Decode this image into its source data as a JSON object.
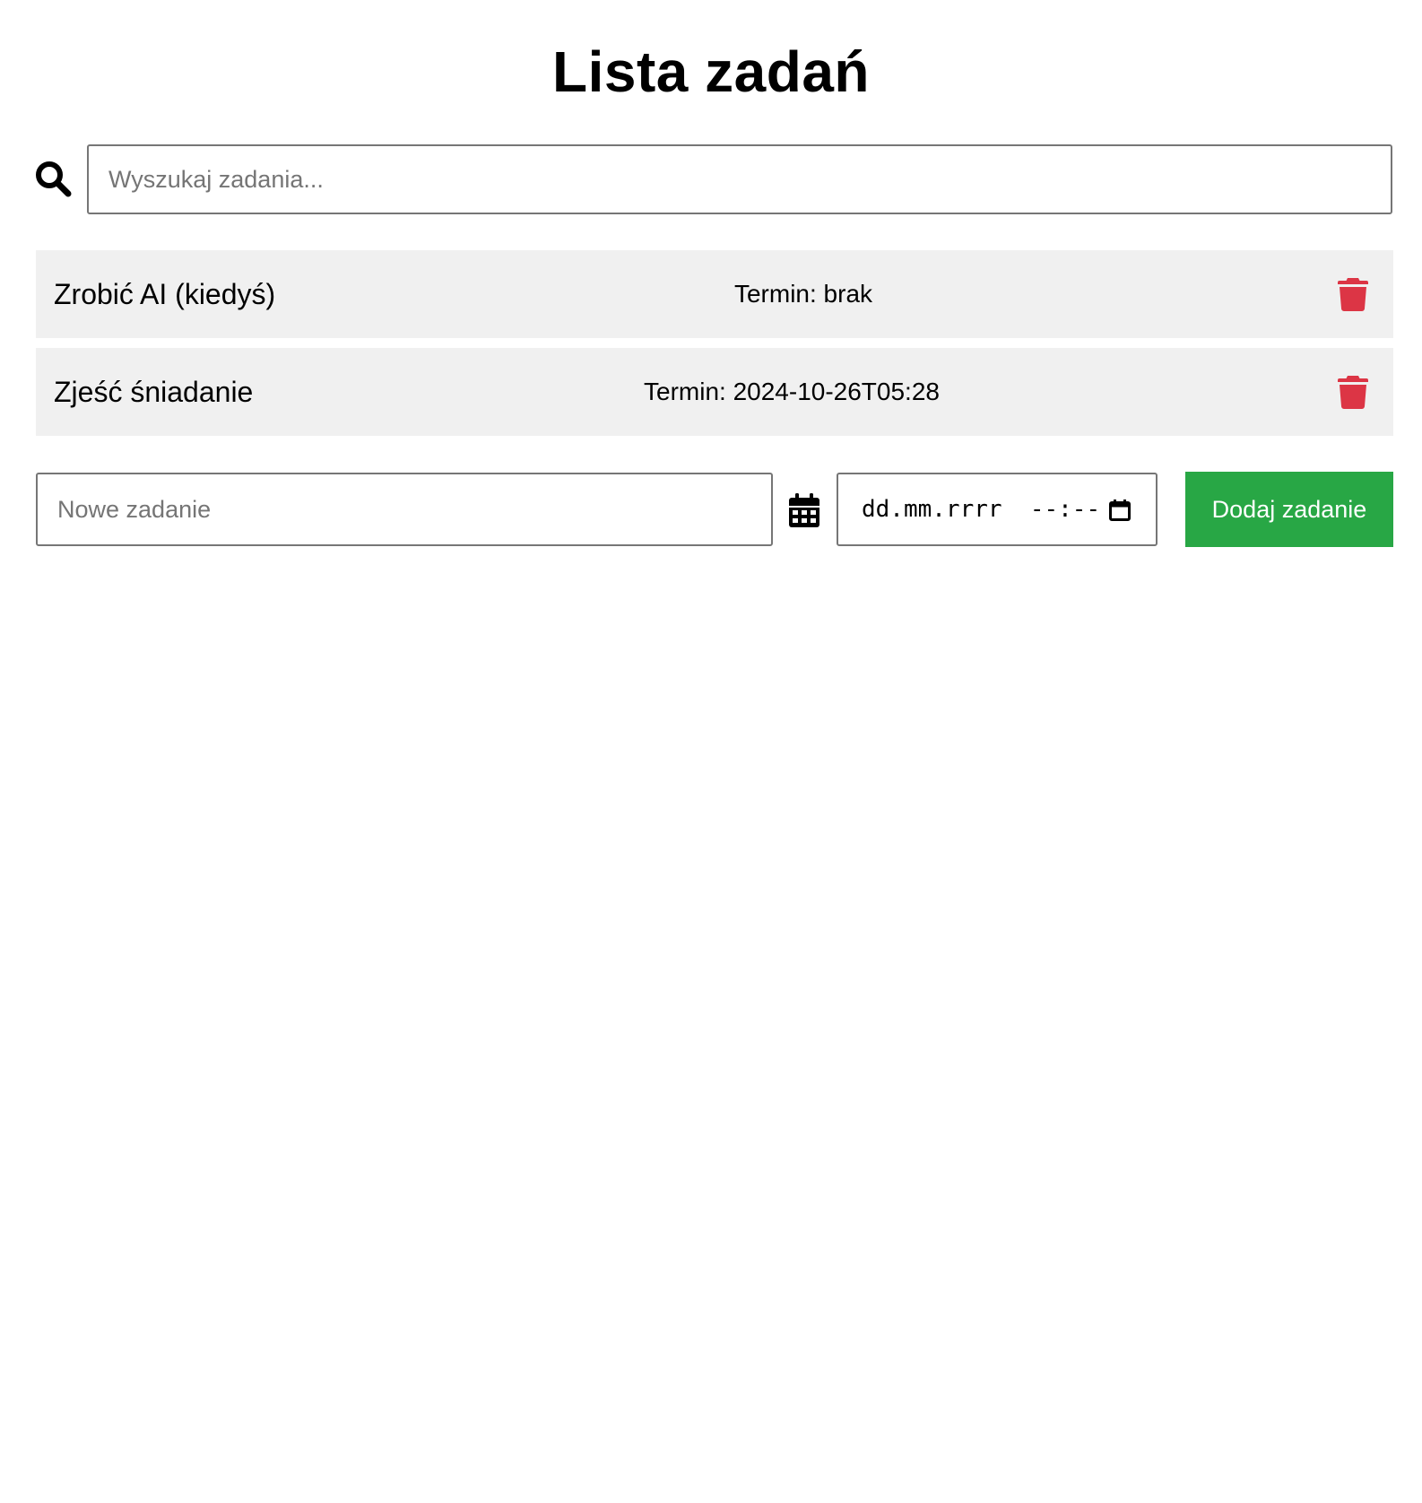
{
  "header": {
    "title": "Lista zadań"
  },
  "search": {
    "icon": "search-icon",
    "placeholder": "Wyszukaj zadania...",
    "value": ""
  },
  "tasks": [
    {
      "name": "Zrobić AI (kiedyś)",
      "deadline": "Termin: brak",
      "delete_icon": "trash-icon"
    },
    {
      "name": "Zjeść śniadanie",
      "deadline": "Termin: 2024-10-26T05:28",
      "delete_icon": "trash-icon"
    }
  ],
  "new_task": {
    "placeholder": "Nowe zadanie",
    "value": "",
    "calendar_icon": "calendar-icon",
    "date_placeholder": "dd.mm.rrrr  --:--",
    "add_label": "Dodaj zadanie"
  },
  "colors": {
    "accent_green": "#28a745",
    "delete_red": "#dc3545",
    "row_background": "#f0f0f0"
  }
}
